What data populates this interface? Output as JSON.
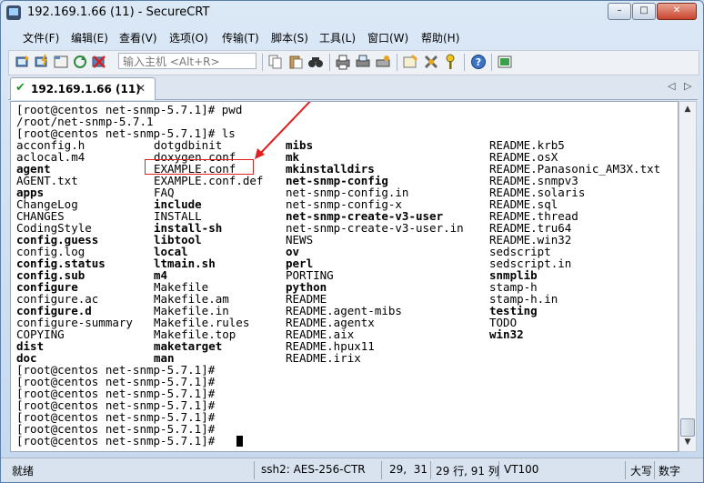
{
  "window": {
    "title": "192.169.1.66 (11) - SecureCRT"
  },
  "title_buttons": {
    "minimize": "–",
    "maximize": "□",
    "close": "✕"
  },
  "menu": [
    "文件(F)",
    "编辑(E)",
    "查看(V)",
    "选项(O)",
    "传输(T)",
    "脚本(S)",
    "工具(L)",
    "窗口(W)",
    "帮助(H)"
  ],
  "toolbar": {
    "quick_connect_placeholder": "输入主机 <Alt+R>"
  },
  "tab": {
    "label": "192.169.1.66 (11)",
    "close": "✕",
    "prev": "◁",
    "next": "▷"
  },
  "terminal": {
    "lines": [
      [
        {
          "t": "[root@centos net-snmp-5.7.1]# pwd"
        }
      ],
      [
        {
          "t": "/root/net-snmp-5.7.1"
        }
      ],
      [
        {
          "t": "[root@centos net-snmp-5.7.1]# ls"
        }
      ],
      [
        {
          "t": "acconfig.h"
        },
        {
          "t": "dotgdbinit"
        },
        {
          "t": "mibs",
          "b": true
        },
        {
          "t": "README.krb5"
        }
      ],
      [
        {
          "t": "aclocal.m4"
        },
        {
          "t": "doxygen.conf"
        },
        {
          "t": "mk",
          "b": true
        },
        {
          "t": "README.osX"
        }
      ],
      [
        {
          "t": "agent",
          "b": true
        },
        {
          "t": "EXAMPLE.conf"
        },
        {
          "t": "mkinstalldirs",
          "b": true
        },
        {
          "t": "README.Panasonic_AM3X.txt"
        }
      ],
      [
        {
          "t": "AGENT.txt"
        },
        {
          "t": "EXAMPLE.conf.def"
        },
        {
          "t": "net-snmp-config",
          "b": true
        },
        {
          "t": "README.snmpv3"
        }
      ],
      [
        {
          "t": "apps",
          "b": true
        },
        {
          "t": "FAQ"
        },
        {
          "t": "net-snmp-config.in"
        },
        {
          "t": "README.solaris"
        }
      ],
      [
        {
          "t": "ChangeLog"
        },
        {
          "t": "include",
          "b": true
        },
        {
          "t": "net-snmp-config-x"
        },
        {
          "t": "README.sql"
        }
      ],
      [
        {
          "t": "CHANGES"
        },
        {
          "t": "INSTALL"
        },
        {
          "t": "net-snmp-create-v3-user",
          "b": true
        },
        {
          "t": "README.thread"
        }
      ],
      [
        {
          "t": "CodingStyle"
        },
        {
          "t": "install-sh",
          "b": true
        },
        {
          "t": "net-snmp-create-v3-user.in"
        },
        {
          "t": "README.tru64"
        }
      ],
      [
        {
          "t": "config.guess",
          "b": true
        },
        {
          "t": "libtool",
          "b": true
        },
        {
          "t": "NEWS"
        },
        {
          "t": "README.win32"
        }
      ],
      [
        {
          "t": "config.log"
        },
        {
          "t": "local",
          "b": true
        },
        {
          "t": "ov",
          "b": true
        },
        {
          "t": "sedscript"
        }
      ],
      [
        {
          "t": "config.status",
          "b": true
        },
        {
          "t": "ltmain.sh",
          "b": true
        },
        {
          "t": "perl",
          "b": true
        },
        {
          "t": "sedscript.in"
        }
      ],
      [
        {
          "t": "config.sub",
          "b": true
        },
        {
          "t": "m4",
          "b": true
        },
        {
          "t": "PORTING"
        },
        {
          "t": "snmplib",
          "b": true
        }
      ],
      [
        {
          "t": "configure",
          "b": true
        },
        {
          "t": "Makefile"
        },
        {
          "t": "python",
          "b": true
        },
        {
          "t": "stamp-h"
        }
      ],
      [
        {
          "t": "configure.ac"
        },
        {
          "t": "Makefile.am"
        },
        {
          "t": "README"
        },
        {
          "t": "stamp-h.in"
        }
      ],
      [
        {
          "t": "configure.d",
          "b": true
        },
        {
          "t": "Makefile.in"
        },
        {
          "t": "README.agent-mibs"
        },
        {
          "t": "testing",
          "b": true
        }
      ],
      [
        {
          "t": "configure-summary"
        },
        {
          "t": "Makefile.rules"
        },
        {
          "t": "README.agentx"
        },
        {
          "t": "TODO"
        }
      ],
      [
        {
          "t": "COPYING"
        },
        {
          "t": "Makefile.top"
        },
        {
          "t": "README.aix"
        },
        {
          "t": "win32",
          "b": true
        }
      ],
      [
        {
          "t": "dist",
          "b": true
        },
        {
          "t": "maketarget",
          "b": true
        },
        {
          "t": "README.hpux11"
        }
      ],
      [
        {
          "t": "doc",
          "b": true
        },
        {
          "t": "man",
          "b": true
        },
        {
          "t": "README.irix"
        }
      ],
      [
        {
          "t": "[root@centos net-snmp-5.7.1]#"
        }
      ],
      [
        {
          "t": "[root@centos net-snmp-5.7.1]#"
        }
      ],
      [
        {
          "t": "[root@centos net-snmp-5.7.1]#"
        }
      ],
      [
        {
          "t": "[root@centos net-snmp-5.7.1]#"
        }
      ],
      [
        {
          "t": "[root@centos net-snmp-5.7.1]#"
        }
      ],
      [
        {
          "t": "[root@centos net-snmp-5.7.1]#"
        }
      ],
      [
        {
          "t": "[root@centos net-snmp-5.7.1]#"
        }
      ]
    ]
  },
  "status": {
    "ready": "就绪",
    "connection": "ssh2: AES-256-CTR",
    "cursor_pos": "29,  31",
    "rows_cols": "29 行, 91 列",
    "terminal_type": "VT100",
    "caps": "大写",
    "numlock": "数字"
  },
  "colors": {
    "annotation": "#e02020",
    "tab_check": "#1b9a2c"
  }
}
